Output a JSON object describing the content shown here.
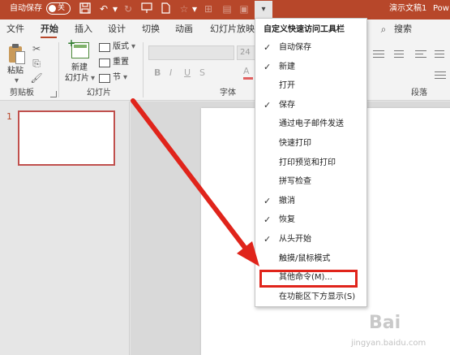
{
  "title_bar": {
    "autosave_label": "自动保存",
    "autosave_state": "关",
    "doc_title": "演示文稿1",
    "app_name": "Pow",
    "qat_icons": [
      "save-icon",
      "undo-icon",
      "redo-icon",
      "start-from-beginning-icon",
      "new-file-icon",
      "touch-mouse-mode-icon",
      "slide-layout-icon",
      "shape-icon",
      "customize-qat-dropdown-icon"
    ]
  },
  "tabs": [
    "文件",
    "开始",
    "插入",
    "设计",
    "切换",
    "动画",
    "幻灯片放映"
  ],
  "active_tab": "开始",
  "search_label": "搜索",
  "ribbon": {
    "paste_label": "粘贴",
    "clipboard_group": "剪贴板",
    "new_slide_label_1": "新建",
    "new_slide_label_2": "幻灯片",
    "layout_label": "版式",
    "reset_label": "重置",
    "section_label": "节",
    "slides_group": "幻灯片",
    "font_size_value": "24",
    "bold": "B",
    "italic": "I",
    "underline": "U",
    "strike": "S",
    "font_color": "A",
    "font_group": "字体",
    "paragraph_group": "段落"
  },
  "slides_pane": {
    "slide_number": "1"
  },
  "qat_menu": {
    "title": "自定义快速访问工具栏",
    "items": [
      {
        "label": "自动保存",
        "checked": true
      },
      {
        "label": "新建",
        "checked": true
      },
      {
        "label": "打开",
        "checked": false
      },
      {
        "label": "保存",
        "checked": true
      },
      {
        "label": "通过电子邮件发送",
        "checked": false
      },
      {
        "label": "快速打印",
        "checked": false
      },
      {
        "label": "打印预览和打印",
        "checked": false
      },
      {
        "label": "拼写检查",
        "checked": false
      },
      {
        "label": "撤消",
        "checked": true
      },
      {
        "label": "恢复",
        "checked": true
      },
      {
        "label": "从头开始",
        "checked": true
      },
      {
        "label": "触摸/鼠标模式",
        "checked": false
      },
      {
        "label": "其他命令(M)...",
        "checked": false
      },
      {
        "label": "在功能区下方显示(S)",
        "checked": false
      }
    ]
  },
  "watermark": {
    "text": "jingyan.baidu.com"
  },
  "colors": {
    "accent": "#b7472a",
    "annotation_red": "#e0241b"
  }
}
